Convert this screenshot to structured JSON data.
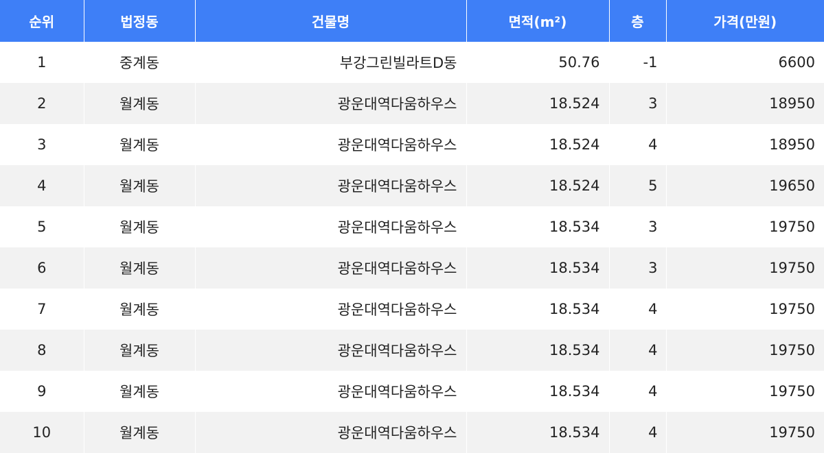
{
  "table": {
    "headers": [
      "순위",
      "법정동",
      "건물명",
      "면적(m²)",
      "층",
      "가격(만원)"
    ],
    "rows": [
      {
        "rank": "1",
        "dong": "중계동",
        "building": "부강그린빌라트D동",
        "area": "50.76",
        "floor": "-1",
        "price": "6600"
      },
      {
        "rank": "2",
        "dong": "월계동",
        "building": "광운대역다움하우스",
        "area": "18.524",
        "floor": "3",
        "price": "18950"
      },
      {
        "rank": "3",
        "dong": "월계동",
        "building": "광운대역다움하우스",
        "area": "18.524",
        "floor": "4",
        "price": "18950"
      },
      {
        "rank": "4",
        "dong": "월계동",
        "building": "광운대역다움하우스",
        "area": "18.524",
        "floor": "5",
        "price": "19650"
      },
      {
        "rank": "5",
        "dong": "월계동",
        "building": "광운대역다움하우스",
        "area": "18.534",
        "floor": "3",
        "price": "19750"
      },
      {
        "rank": "6",
        "dong": "월계동",
        "building": "광운대역다움하우스",
        "area": "18.534",
        "floor": "3",
        "price": "19750"
      },
      {
        "rank": "7",
        "dong": "월계동",
        "building": "광운대역다움하우스",
        "area": "18.534",
        "floor": "4",
        "price": "19750"
      },
      {
        "rank": "8",
        "dong": "월계동",
        "building": "광운대역다움하우스",
        "area": "18.534",
        "floor": "4",
        "price": "19750"
      },
      {
        "rank": "9",
        "dong": "월계동",
        "building": "광운대역다움하우스",
        "area": "18.534",
        "floor": "4",
        "price": "19750"
      },
      {
        "rank": "10",
        "dong": "월계동",
        "building": "광운대역다움하우스",
        "area": "18.534",
        "floor": "4",
        "price": "19750"
      }
    ]
  },
  "colors": {
    "header_bg": "#3e7ff7",
    "header_text": "#ffffff",
    "alt_row_bg": "#f2f2f2"
  }
}
